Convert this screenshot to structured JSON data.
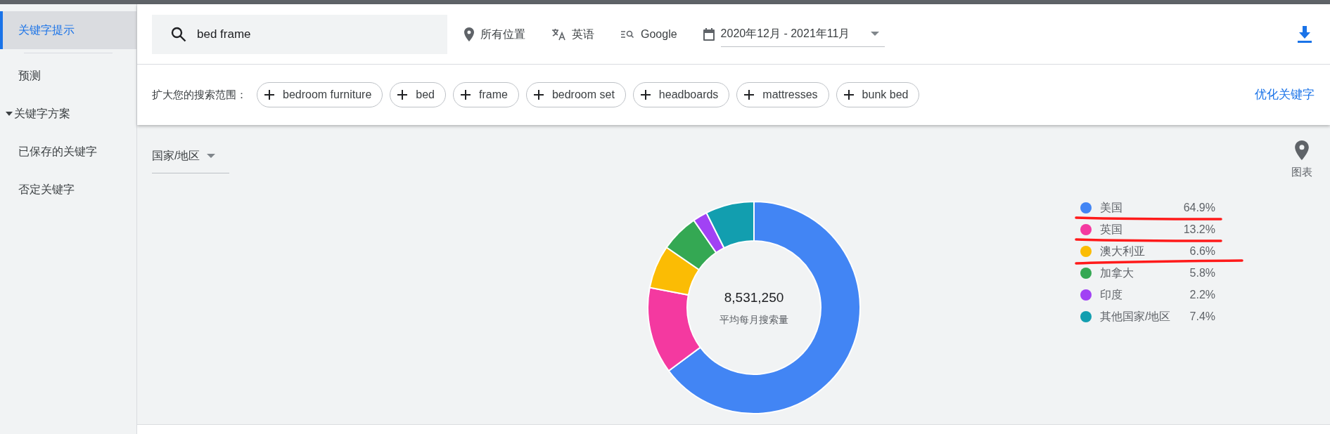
{
  "sidebar": {
    "items": [
      {
        "label": "关键字提示",
        "selected": true
      },
      {
        "label": "预测",
        "selected": false
      },
      {
        "label": "关键字方案",
        "selected": false,
        "expanded": true
      },
      {
        "label": "已保存的关键字",
        "selected": false
      },
      {
        "label": "否定关键字",
        "selected": false
      }
    ]
  },
  "search": {
    "value": "bed frame"
  },
  "filters": [
    {
      "kind": "location",
      "label": "所有位置"
    },
    {
      "kind": "language",
      "label": "英语"
    },
    {
      "kind": "network",
      "label": "Google"
    },
    {
      "kind": "date",
      "label": "2020年12月 - 2021年11月"
    }
  ],
  "broaden": {
    "label": "扩大您的搜索范围：",
    "chips": [
      "bedroom furniture",
      "bed",
      "frame",
      "bedroom set",
      "headboards",
      "mattresses",
      "bunk bed"
    ],
    "link": "优化关键字"
  },
  "breakdown": {
    "dropdown": "国家/地区",
    "view_toggle": "图表",
    "total": "8,531,250",
    "total_label": "平均每月搜索量",
    "legend": [
      {
        "share": "64.9%",
        "color": "#4285f4",
        "underlined": true
      },
      {
        "share": "13.2%",
        "color": "#f439a0",
        "underlined": true
      },
      {
        "share": "6.6%",
        "color": "#fbbc04",
        "underlined": true
      },
      {
        "share": "5.8%",
        "color": "#34a853",
        "underlined": false
      },
      {
        "share": "2.2%",
        "color": "#a142f4",
        "underlined": false
      },
      {
        "share": "7.4%",
        "color": "#129eaf",
        "underlined": false
      }
    ],
    "chart_data": {
      "type": "donut",
      "categories": [
        "美国",
        "英国",
        "澳大利亚",
        "加拿大",
        "印度",
        "其他国家/地区"
      ],
      "values": [
        64.9,
        13.2,
        6.6,
        5.8,
        2.2,
        7.4
      ]
    }
  }
}
